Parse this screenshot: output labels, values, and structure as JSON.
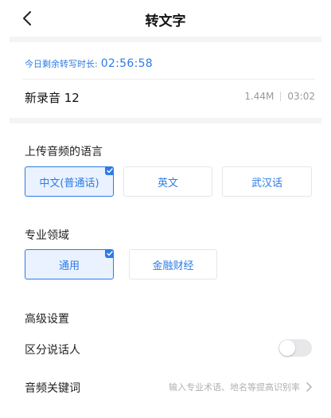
{
  "header": {
    "title": "转文字"
  },
  "quota": {
    "label": "今日剩余转写时长:",
    "value": "02:56:58"
  },
  "recording": {
    "name": "新录音 12",
    "size": "1.44M",
    "duration": "03:02"
  },
  "language": {
    "title": "上传音频的语言",
    "options": [
      {
        "label": "中文(普通话)",
        "selected": true
      },
      {
        "label": "英文",
        "selected": false
      },
      {
        "label": "武汉话",
        "selected": false
      }
    ]
  },
  "domain": {
    "title": "专业领域",
    "options": [
      {
        "label": "通用",
        "selected": true
      },
      {
        "label": "金融财经",
        "selected": false
      }
    ]
  },
  "advanced": {
    "title": "高级设置",
    "speaker_label": "区分说话人",
    "speaker_enabled": false,
    "keyword_label": "音频关键词",
    "keyword_placeholder": "输入专业术语、地名等提高识别率"
  },
  "colors": {
    "accent": "#2e7be6",
    "selected_bg": "#e9f2fe",
    "band": "#f3f4f6"
  },
  "icons": {
    "back": "chevron-left-icon",
    "check": "check-icon",
    "forward": "chevron-right-icon"
  }
}
